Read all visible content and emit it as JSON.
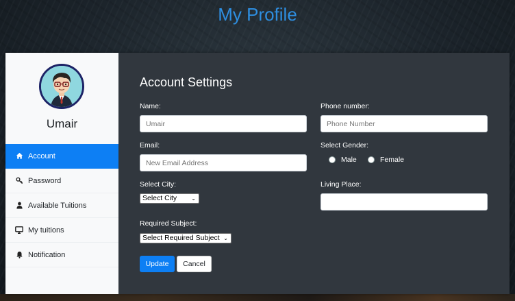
{
  "page": {
    "title": "My Profile"
  },
  "sidebar": {
    "username": "Umair",
    "items": [
      {
        "label": "Account",
        "icon": "home-icon",
        "active": true
      },
      {
        "label": "Password",
        "icon": "key-icon",
        "active": false
      },
      {
        "label": "Available Tuitions",
        "icon": "user-icon",
        "active": false
      },
      {
        "label": "My tuitions",
        "icon": "monitor-icon",
        "active": false
      },
      {
        "label": "Notification",
        "icon": "bell-icon",
        "active": false
      }
    ]
  },
  "form": {
    "heading": "Account Settings",
    "name": {
      "label": "Name:",
      "placeholder": "Umair"
    },
    "phone": {
      "label": "Phone number:",
      "placeholder": "Phone Number"
    },
    "email": {
      "label": "Email:",
      "placeholder": "New Email Address"
    },
    "gender": {
      "label": "Select Gender:",
      "options": [
        "Male",
        "Female"
      ]
    },
    "city": {
      "label": "Select City:",
      "selected": "Select City"
    },
    "living_place": {
      "label": "Living Place:",
      "value": ""
    },
    "subject": {
      "label": "Required Subject:",
      "selected": "Select Required Subject"
    },
    "buttons": {
      "update": "Update",
      "cancel": "Cancel"
    }
  },
  "colors": {
    "accent": "#0d7ff4",
    "title": "#2e8ee0",
    "panel": "#31373e",
    "sidebar": "#f8f9fa"
  }
}
